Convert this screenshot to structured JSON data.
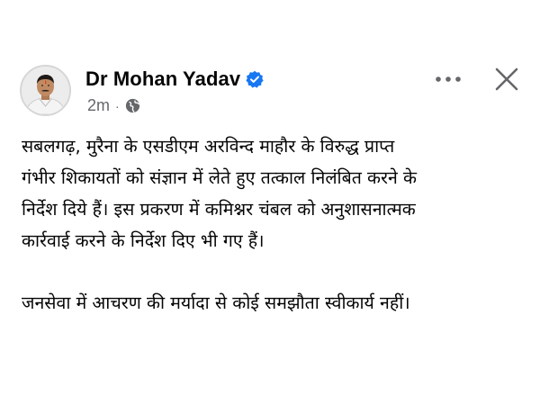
{
  "post": {
    "author": "Dr Mohan Yadav",
    "timestamp": "2m",
    "separator": "·",
    "privacy_icon": "globe-icon",
    "verified_icon": "verified-badge-icon",
    "more_icon": "more-options-icon",
    "close_icon": "close-icon",
    "paragraphs": [
      "सबलगढ़, मुरैना के एसडीएम अरविन्द माहौर के विरुद्ध प्राप्त\nगंभीर शिकायतों को संज्ञान में लेते हुए तत्काल निलंबित करने के\nनिर्देश दिये हैं। इस प्रकरण में कमिश्नर चंबल को अनुशासनात्मक\nकार्रवाई करने के निर्देश दिए भी गए हैं।",
      "जनसेवा में आचरण की मर्यादा से कोई समझौता स्वीकार्य नहीं।"
    ]
  },
  "colors": {
    "name": "#050505",
    "meta": "#65676b",
    "verified": "#1877f2",
    "icon": "#65676b",
    "avatar_bg": "#e9e9e9"
  }
}
